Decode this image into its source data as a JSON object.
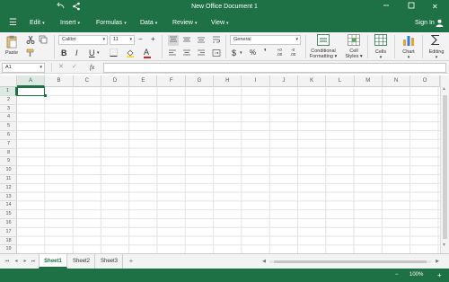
{
  "titlebar": {
    "title": "New Office Document 1",
    "icons": [
      "back-arrow-icon",
      "share-icon",
      "minimize-icon",
      "maximize-icon",
      "close-icon"
    ],
    "close_glyph": "✕"
  },
  "menubar": {
    "menu_glyph": "☰",
    "items": [
      {
        "label": "Edit",
        "caret": "▾"
      },
      {
        "label": "Insert",
        "caret": "▾"
      },
      {
        "label": "Formulas",
        "caret": "▾"
      },
      {
        "label": "Data",
        "caret": "▾"
      },
      {
        "label": "Review",
        "caret": "▾"
      },
      {
        "label": "View",
        "caret": "▾"
      }
    ],
    "sign_in": "Sign In"
  },
  "ribbon": {
    "paste": "Paste",
    "font_name": "Calibri",
    "font_size": "11",
    "decrease_size": "−",
    "increase_size": "+",
    "bold": "B",
    "italic": "I",
    "underline": "U",
    "font_color": "A",
    "number_format": "General",
    "currency": "$",
    "percent": "%",
    "comma": "❜",
    "inc_decimal": "+0\n.00",
    "dec_decimal": "-0\n.00",
    "conditional_formatting": "Conditional Formatting ▾",
    "cell_styles": "Cell Styles ▾",
    "cells": "Cells",
    "chart": "Chart",
    "editing": "Editing",
    "dropdown_caret": "▾"
  },
  "formula_bar": {
    "cell_ref": "A1",
    "cancel": "✕",
    "enter": "✓",
    "fx": "fx",
    "value": ""
  },
  "grid": {
    "columns": [
      "A",
      "B",
      "C",
      "D",
      "E",
      "F",
      "G",
      "H",
      "I",
      "J",
      "K",
      "L",
      "M",
      "N",
      "O"
    ],
    "rows": [
      "1",
      "2",
      "3",
      "4",
      "5",
      "6",
      "7",
      "8",
      "9",
      "10",
      "11",
      "12",
      "13",
      "14",
      "15",
      "16",
      "17",
      "18",
      "19"
    ],
    "active_cell": "A1"
  },
  "sheets": {
    "tabs": [
      "Sheet1",
      "Sheet2",
      "Sheet3"
    ],
    "active": "Sheet1",
    "add": "+",
    "nav": [
      "⏮",
      "◂",
      "▸",
      "⏭"
    ]
  },
  "status": {
    "zoom": "100%",
    "zoom_out": "−",
    "zoom_in": "+"
  },
  "colors": {
    "brand_green": "#1e7145",
    "ribbon_bg": "#f3f3f3"
  }
}
